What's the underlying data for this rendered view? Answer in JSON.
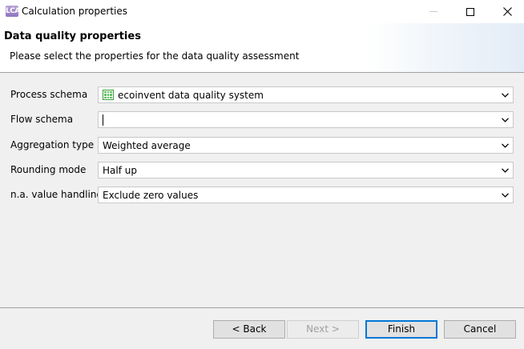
{
  "window": {
    "title": "Calculation properties",
    "logo_text": "LCA"
  },
  "header": {
    "title": "Data quality properties",
    "description": "Please select the properties for the data quality assessment"
  },
  "form": {
    "rows": [
      {
        "label": "Process schema",
        "value": "ecoinvent data quality system",
        "icon": "grid-table-icon"
      },
      {
        "label": "Flow schema",
        "value": "",
        "placeholder": ""
      },
      {
        "label": "Aggregation type",
        "value": "Weighted average"
      },
      {
        "label": "Rounding mode",
        "value": "Half up"
      },
      {
        "label": "n.a. value handling",
        "value": "Exclude zero values"
      }
    ]
  },
  "buttons": {
    "back": "< Back",
    "next": "Next >",
    "finish": "Finish",
    "cancel": "Cancel"
  },
  "colors": {
    "accent": "#0078d7",
    "icon_green": "#3a9d3a"
  }
}
